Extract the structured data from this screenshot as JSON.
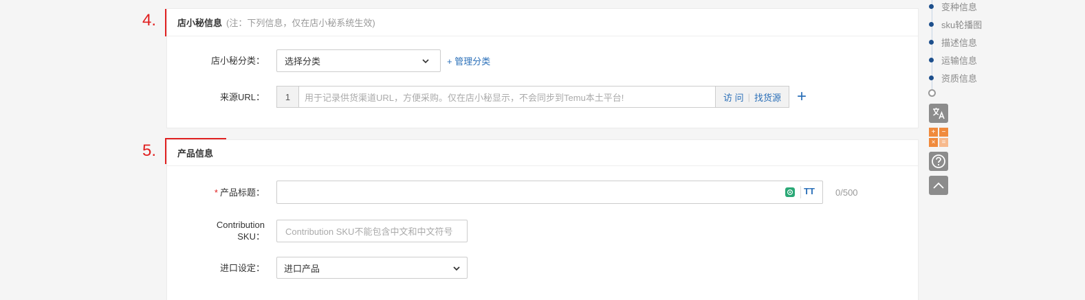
{
  "section4": {
    "step": "4.",
    "title": "店小秘信息",
    "note": "(注：下列信息，仅在店小秘系统生效)",
    "category": {
      "label": "店小秘分类：",
      "value": "选择分类",
      "manage_link": "+ 管理分类"
    },
    "source_url": {
      "label": "来源URL：",
      "index": "1",
      "placeholder": "用于记录供货渠道URL，方便采购。仅在店小秘显示，不会同步到Temu本土平台!",
      "visit": "访 问",
      "sep": "|",
      "find": "找货源",
      "add": "+"
    }
  },
  "section5": {
    "step": "5.",
    "title": "产品信息",
    "product_title": {
      "required": "*",
      "label": "产品标题：",
      "ai_icon": "ai-icon",
      "tt": "TT",
      "counter": "0/500"
    },
    "contribution_sku": {
      "label_line1": "Contribution",
      "label_line2": "SKU：",
      "placeholder": "Contribution SKU不能包含中文和中文符号"
    },
    "import_setting": {
      "label": "进口设定：",
      "value": "进口产品"
    }
  },
  "right_nav": {
    "items": [
      "变种信息",
      "sku轮播图",
      "描述信息",
      "运输信息",
      "资质信息"
    ],
    "tools": [
      "translate-icon",
      "calculator-icon",
      "help-icon",
      "back-to-top-icon"
    ]
  },
  "colors": {
    "accent_red": "#e02020",
    "link_blue": "#2a6fb8",
    "nav_dot": "#1d4f8c"
  }
}
